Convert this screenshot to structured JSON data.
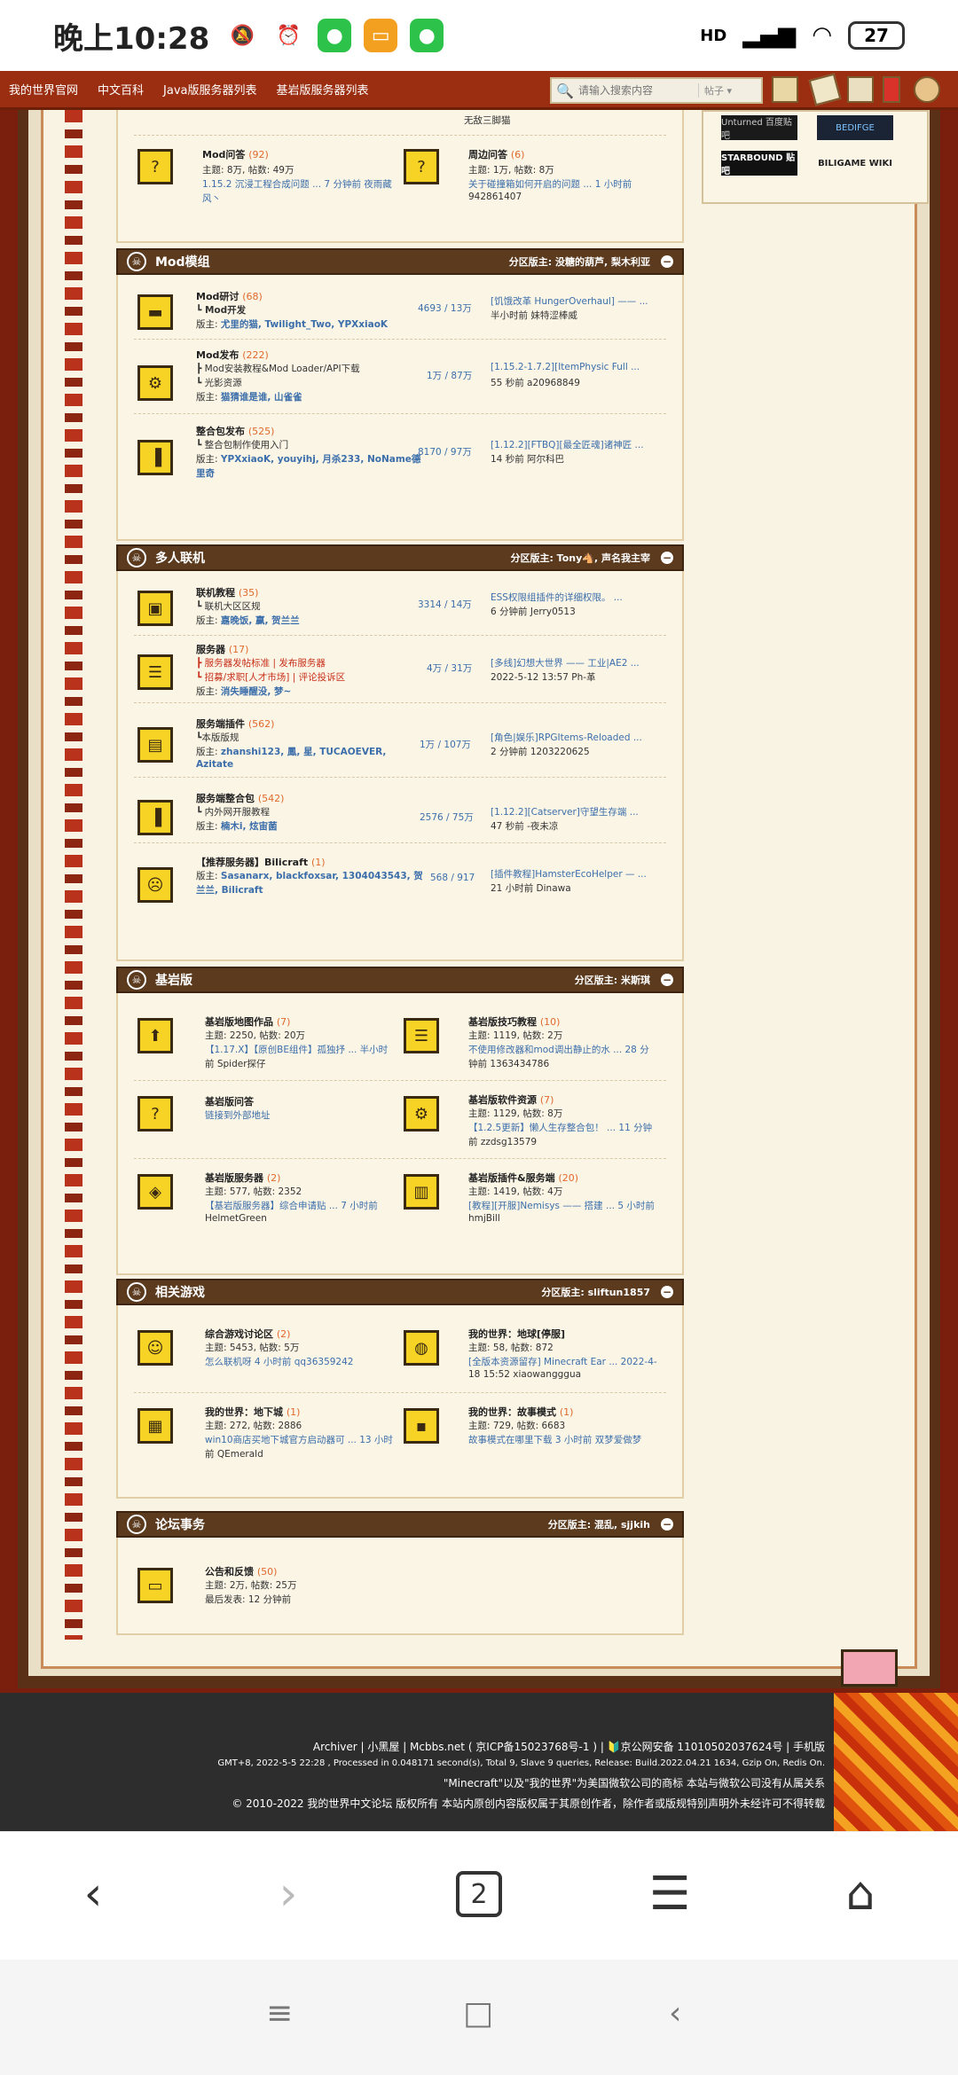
{
  "status": {
    "time": "晚上10:28",
    "battery": "27",
    "network": "HD"
  },
  "nav": {
    "links": [
      "我的世界官网",
      "中文百科",
      "Java版服务器列表",
      "基岩版服务器列表"
    ],
    "search_placeholder": "请输入搜索内容",
    "search_type": "帖子"
  },
  "top": {
    "mod_qa": {
      "name": "Mod问答",
      "count": "(92)",
      "stats": "主题: 8万, 帖数: 49万",
      "last": "1.15.2 沉浸工程合成问题 ... 7 分钟前 夜雨藏",
      "last2": "风丶"
    },
    "peripheral": {
      "name": "周边问答",
      "count": "(6)",
      "stats": "主题: 1万, 帖数: 8万",
      "last": "关于碰撞箱如何开启的问题 ... 1 小时前",
      "last2": "942861407"
    },
    "cut_text": "无敌三脚猫"
  },
  "sidebar": {
    "tags": [
      "Unturned 百度贴吧",
      "BEDIFGE",
      "STARBOUND 贴吧",
      "BILIGAME WIKI"
    ]
  },
  "mod": {
    "title": "Mod模组",
    "mods": "分区版主: 没糖的葫芦, 梨木利亚",
    "rows": [
      {
        "name": "Mod研讨",
        "count": "(68)",
        "sub": "┗ Mod开发",
        "mods_label": "版主: ",
        "mods": "尤里的猫, Twilight_Two, YPXxiaoK",
        "stat": "4693 / 13万",
        "last": "[饥饿改革 HungerOverhaul] —— ...",
        "last2": "半小时前 妹特涩棒威"
      },
      {
        "name": "Mod发布",
        "count": "(222)",
        "sub": "┣ Mod安装教程&Mod Loader/API下载",
        "sub2": "┗ 光影资源",
        "mods_label": "版主: ",
        "mods": "猫猜谁是谁, 山雀雀",
        "stat": "1万 / 87万",
        "last": "[1.15.2-1.7.2][ItemPhysic Full ...",
        "last2": "55 秒前 a20968849"
      },
      {
        "name": "整合包发布",
        "count": "(525)",
        "sub": "┗ 整合包制作使用入门",
        "mods_label": "版主: ",
        "mods": "YPXxiaoK, youyihj, 月杀233, NoName德",
        "mods2": "里奇",
        "stat": "8170 / 97万",
        "last": "[1.12.2][FTBQ][最全匠魂]诸神匠 ...",
        "last2": "14 秒前 阿尔科巴"
      }
    ]
  },
  "multi": {
    "title": "多人联机",
    "mods": "分区版主: Tony🐴, 声名我主宰",
    "rows": [
      {
        "name": "联机教程",
        "count": "(35)",
        "sub": "┗ 联机大区区规",
        "mods_label": "版主: ",
        "mods": "嘉晚饭, 赢, 贺兰兰",
        "stat": "3314 / 14万",
        "last": "ESS权限组插件的详细权限。 ...",
        "last2": "6 分钟前 Jerry0513"
      },
      {
        "name": "服务器",
        "count": "(17)",
        "sub": "┣ 服务器发帖标准 | 发布服务器",
        "sub2": "┗ 招募/求职[人才市场] | 评论投诉区",
        "mods_label": "版主: ",
        "mods": "消失睡醒没, 梦~",
        "stat": "4万 / 31万",
        "last": "[多线]幻想大世界 —— 工业|AE2 ...",
        "last2": "2022-5-12 13:57 Ph-革"
      },
      {
        "name": "服务端插件",
        "count": "(562)",
        "sub": "┗本版版规",
        "mods_label": "版主: ",
        "mods": "zhanshi123, 鳳, 星, TUCAOEVER,",
        "mods2": "Azitate",
        "stat": "1万 / 107万",
        "last": "[角色|娱乐]RPGItems-Reloaded ...",
        "last2": "2 分钟前 1203220625"
      },
      {
        "name": "服务端整合包",
        "count": "(542)",
        "sub": "┗ 内外网开服教程",
        "mods_label": "版主: ",
        "mods": "楠木i, 炫宙菌",
        "stat": "2576 / 75万",
        "last": "[1.12.2][Catserver]守望生存端 ...",
        "last2": "47 秒前 -夜未凉"
      },
      {
        "name": "【推荐服务器】Bilicraft",
        "count": "(1)",
        "mods_label": "版主: ",
        "mods": "Sasanarx, blackfoxsar, 1304043543, 贺",
        "mods2": "兰兰, Bilicraft",
        "stat": "568 / 917",
        "last": "[插件教程]HamsterEcoHelper — ...",
        "last2": "21 小时前 Dinawa"
      }
    ]
  },
  "bedrock": {
    "title": "基岩版",
    "mods": "分区版主: 米斯琪",
    "cells": [
      {
        "name": "基岩版地图作品",
        "count": "(7)",
        "stats": "主题: 2250, 帖数: 20万",
        "last": "【1.17.X】【原创BE组件】孤独抒 ... 半小时",
        "last2": "前 Spider探仔"
      },
      {
        "name": "基岩版技巧教程",
        "count": "(10)",
        "stats": "主题: 1119, 帖数: 2万",
        "last": "不使用修改器和mod调出静止的水 ... 28 分",
        "last2": "钟前 1363434786"
      },
      {
        "name": "基岩版问答",
        "count": "",
        "stats": "链接到外部地址",
        "last": "",
        "last2": ""
      },
      {
        "name": "基岩版软件资源",
        "count": "(7)",
        "stats": "主题: 1129, 帖数: 8万",
        "last": "【1.2.5更新】懒人生存整合包！ ... 11 分钟",
        "last2": "前 zzdsg13579"
      },
      {
        "name": "基岩版服务器",
        "count": "(2)",
        "stats": "主题: 577, 帖数: 2352",
        "last": "【基岩版服务器】综合申请贴 ... 7 小时前",
        "last2": "HelmetGreen"
      },
      {
        "name": "基岩版插件&服务端",
        "count": "(20)",
        "stats": "主题: 1419, 帖数: 4万",
        "last": "[教程][开服]Nemisys —— 搭建 ... 5 小时前",
        "last2": "hmjBill"
      }
    ]
  },
  "related": {
    "title": "相关游戏",
    "mods": "分区版主: sliftun1857",
    "cells": [
      {
        "name": "综合游戏讨论区",
        "count": "(2)",
        "stats": "主题: 5453, 帖数: 5万",
        "last": "怎么联机呀 4 小时前 qq36359242",
        "last2": ""
      },
      {
        "name": "我的世界：地球[停服]",
        "count": "",
        "stats": "主题: 58, 帖数: 872",
        "last": "[全版本资源留存] Minecraft Ear ... 2022-4-",
        "last2": "18 15:52 xiaowangggua"
      },
      {
        "name": "我的世界：地下城",
        "count": "(1)",
        "stats": "主题: 272, 帖数: 2886",
        "last": "win10商店买地下城官方启动器可 ... 13 小时",
        "last2": "前 QEmerald"
      },
      {
        "name": "我的世界：故事模式",
        "count": "(1)",
        "stats": "主题: 729, 帖数: 6683",
        "last": "故事模式在哪里下载 3 小时前 双梦爱做梦",
        "last2": ""
      }
    ]
  },
  "affairs": {
    "title": "论坛事务",
    "mods": "分区版主: 混乱, sjjkih",
    "row": {
      "name": "公告和反馈",
      "count": "(50)",
      "stats": "主题: 2万, 帖数: 25万",
      "last": "最后发表: 12 分钟前"
    }
  },
  "footer": {
    "line1": "Archiver | 小黑屋 | Mcbbs.net ( 京ICP备15023768号-1 ) | 🔰京公网安备 11010502037624号 | 手机版",
    "line2": "GMT+8, 2022-5-5 22:28 , Processed in 0.048171 second(s), Total 9, Slave 9 queries, Release: Build.2022.04.21 1634, Gzip On, Redis On.",
    "line3": "\"Minecraft\"以及\"我的世界\"为美国微软公司的商标 本站与微软公司没有从属关系",
    "line4": "© 2010-2022 我的世界中文论坛 版权所有 本站内原创内容版权属于其原创作者，除作者或版规特别声明外未经许可不得转载"
  },
  "browser": {
    "tabs": "2"
  }
}
